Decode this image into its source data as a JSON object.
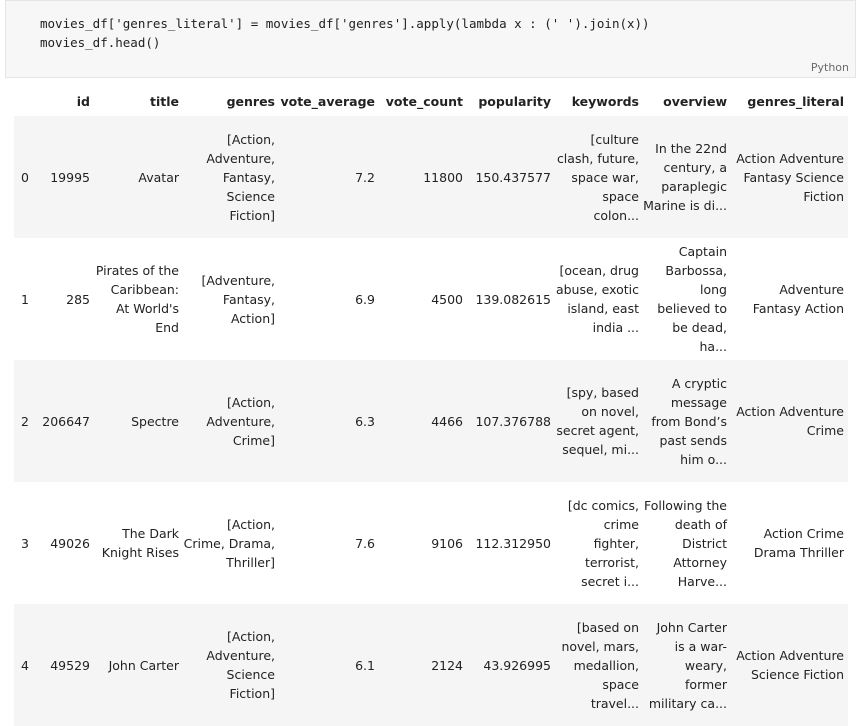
{
  "cell": {
    "code_lines": [
      "movies_df['genres_literal'] = movies_df['genres'].apply(lambda x : (' ').join(x))",
      "movies_df.head()"
    ],
    "language": "Python"
  },
  "table": {
    "columns": [
      "",
      "id",
      "title",
      "genres",
      "vote_average",
      "vote_count",
      "popularity",
      "keywords",
      "overview",
      "genres_literal"
    ],
    "rows": [
      {
        "index": "0",
        "id": "19995",
        "title": "Avatar",
        "genres": "[Action, Adventure, Fantasy, Science Fiction]",
        "vote_average": "7.2",
        "vote_count": "11800",
        "popularity": "150.437577",
        "keywords": "[culture clash, future, space war, space colon...",
        "overview": "In the 22nd century, a paraplegic Marine is di...",
        "genres_literal": "Action Adventure Fantasy Science Fiction"
      },
      {
        "index": "1",
        "id": "285",
        "title": "Pirates of the Caribbean: At World's End",
        "genres": "[Adventure, Fantasy, Action]",
        "vote_average": "6.9",
        "vote_count": "4500",
        "popularity": "139.082615",
        "keywords": "[ocean, drug abuse, exotic island, east india ...",
        "overview": "Captain Barbossa, long believed to be dead, ha...",
        "genres_literal": "Adventure Fantasy Action"
      },
      {
        "index": "2",
        "id": "206647",
        "title": "Spectre",
        "genres": "[Action, Adventure, Crime]",
        "vote_average": "6.3",
        "vote_count": "4466",
        "popularity": "107.376788",
        "keywords": "[spy, based on novel, secret agent, sequel, mi...",
        "overview": "A cryptic message from Bond’s past sends him o...",
        "genres_literal": "Action Adventure Crime"
      },
      {
        "index": "3",
        "id": "49026",
        "title": "The Dark Knight Rises",
        "genres": "[Action, Crime, Drama, Thriller]",
        "vote_average": "7.6",
        "vote_count": "9106",
        "popularity": "112.312950",
        "keywords": "[dc comics, crime fighter, terrorist, secret i...",
        "overview": "Following the death of District Attorney Harve...",
        "genres_literal": "Action Crime Drama Thriller"
      },
      {
        "index": "4",
        "id": "49529",
        "title": "John Carter",
        "genres": "[Action, Adventure, Science Fiction]",
        "vote_average": "6.1",
        "vote_count": "2124",
        "popularity": "43.926995",
        "keywords": "[based on novel, mars, medallion, space travel...",
        "overview": "John Carter is a war-weary, former military ca...",
        "genres_literal": "Action Adventure Science Fiction"
      }
    ]
  }
}
